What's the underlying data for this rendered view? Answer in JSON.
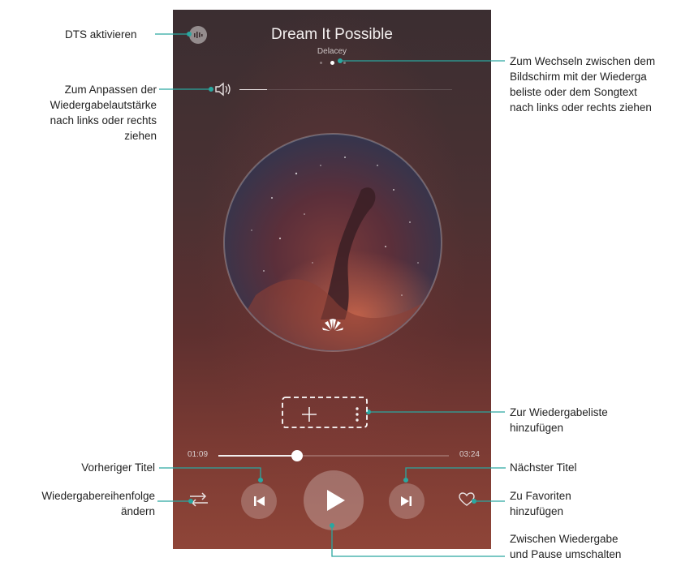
{
  "player": {
    "song_title": "Dream It Possible",
    "artist": "Delacey",
    "current_time": "01:09",
    "total_time": "03:24",
    "progress": 0.34,
    "page_indicator_active": 1,
    "page_indicator_count": 3,
    "album_art_brand": "HUAWEI"
  },
  "annotations": {
    "dts": "DTS aktivieren",
    "volume": [
      "Zum Anpassen der",
      "Wiedergabelautstärke",
      "nach links oder rechts",
      "ziehen"
    ],
    "swipe": [
      "Zum Wechseln zwischen dem",
      "Bildschirm mit der Wiederga",
      "beliste oder dem Songtext",
      "nach links oder rechts ziehen"
    ],
    "playlist": [
      "Zur Wiedergabeliste",
      "hinzufügen"
    ],
    "previous": "Vorheriger Titel",
    "next": "Nächster Titel",
    "order": [
      "Wiedergabereihenfolge",
      "ändern"
    ],
    "favorite": [
      "Zu Favoriten",
      "hinzufügen"
    ],
    "playpause": [
      "Zwischen Wiedergabe",
      "und Pause umschalten"
    ]
  },
  "colors": {
    "callout_line": "#2aa7a0",
    "accent_dot": "#ffffff"
  },
  "icons": [
    "dts-icon",
    "volume-icon",
    "add-icon",
    "more-icon",
    "shuffle-icon",
    "previous-icon",
    "play-icon",
    "next-icon",
    "heart-icon"
  ]
}
